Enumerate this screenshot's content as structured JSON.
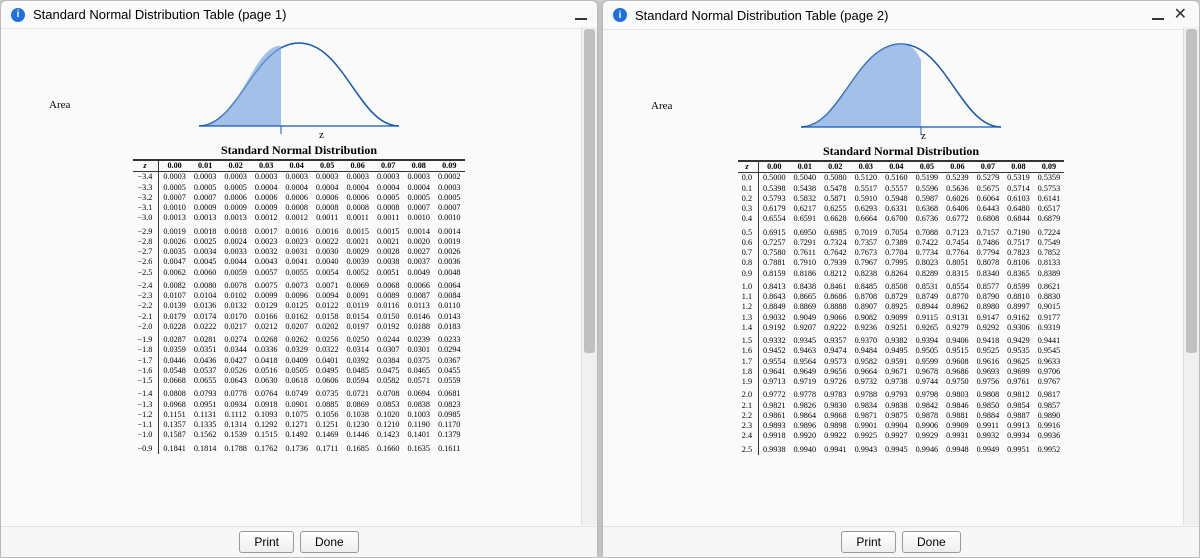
{
  "windows": [
    {
      "title": "Standard Normal Distribution Table (page 1)",
      "dist_title": "Standard Normal Distribution",
      "area_label": "Area",
      "z_label": "z"
    },
    {
      "title": "Standard Normal Distribution Table (page 2)",
      "dist_title": "Standard Normal Distribution",
      "area_label": "Area",
      "z_label": "z"
    }
  ],
  "buttons": {
    "print": "Print",
    "done": "Done"
  },
  "col_headers": [
    "z",
    "0.00",
    "0.01",
    "0.02",
    "0.03",
    "0.04",
    "0.05",
    "0.06",
    "0.07",
    "0.08",
    "0.09"
  ],
  "chart_data": [
    {
      "type": "table",
      "title": "Standard Normal Distribution (page 1, negative z)",
      "headers": [
        "z",
        "0.00",
        "0.01",
        "0.02",
        "0.03",
        "0.04",
        "0.05",
        "0.06",
        "0.07",
        "0.08",
        "0.09"
      ],
      "rows": [
        [
          "−3.4",
          "0.0003",
          "0.0003",
          "0.0003",
          "0.0003",
          "0.0003",
          "0.0003",
          "0.0003",
          "0.0003",
          "0.0003",
          "0.0002"
        ],
        [
          "−3.3",
          "0.0005",
          "0.0005",
          "0.0005",
          "0.0004",
          "0.0004",
          "0.0004",
          "0.0004",
          "0.0004",
          "0.0004",
          "0.0003"
        ],
        [
          "−3.2",
          "0.0007",
          "0.0007",
          "0.0006",
          "0.0006",
          "0.0006",
          "0.0006",
          "0.0006",
          "0.0005",
          "0.0005",
          "0.0005"
        ],
        [
          "−3.1",
          "0.0010",
          "0.0009",
          "0.0009",
          "0.0009",
          "0.0008",
          "0.0008",
          "0.0008",
          "0.0008",
          "0.0007",
          "0.0007"
        ],
        [
          "−3.0",
          "0.0013",
          "0.0013",
          "0.0013",
          "0.0012",
          "0.0012",
          "0.0011",
          "0.0011",
          "0.0011",
          "0.0010",
          "0.0010"
        ],
        [
          "−2.9",
          "0.0019",
          "0.0018",
          "0.0018",
          "0.0017",
          "0.0016",
          "0.0016",
          "0.0015",
          "0.0015",
          "0.0014",
          "0.0014"
        ],
        [
          "−2.8",
          "0.0026",
          "0.0025",
          "0.0024",
          "0.0023",
          "0.0023",
          "0.0022",
          "0.0021",
          "0.0021",
          "0.0020",
          "0.0019"
        ],
        [
          "−2.7",
          "0.0035",
          "0.0034",
          "0.0033",
          "0.0032",
          "0.0031",
          "0.0030",
          "0.0029",
          "0.0028",
          "0.0027",
          "0.0026"
        ],
        [
          "−2.6",
          "0.0047",
          "0.0045",
          "0.0044",
          "0.0043",
          "0.0041",
          "0.0040",
          "0.0039",
          "0.0038",
          "0.0037",
          "0.0036"
        ],
        [
          "−2.5",
          "0.0062",
          "0.0060",
          "0.0059",
          "0.0057",
          "0.0055",
          "0.0054",
          "0.0052",
          "0.0051",
          "0.0049",
          "0.0048"
        ],
        [
          "−2.4",
          "0.0082",
          "0.0080",
          "0.0078",
          "0.0075",
          "0.0073",
          "0.0071",
          "0.0069",
          "0.0068",
          "0.0066",
          "0.0064"
        ],
        [
          "−2.3",
          "0.0107",
          "0.0104",
          "0.0102",
          "0.0099",
          "0.0096",
          "0.0094",
          "0.0091",
          "0.0089",
          "0.0087",
          "0.0084"
        ],
        [
          "−2.2",
          "0.0139",
          "0.0136",
          "0.0132",
          "0.0129",
          "0.0125",
          "0.0122",
          "0.0119",
          "0.0116",
          "0.0113",
          "0.0110"
        ],
        [
          "−2.1",
          "0.0179",
          "0.0174",
          "0.0170",
          "0.0166",
          "0.0162",
          "0.0158",
          "0.0154",
          "0.0150",
          "0.0146",
          "0.0143"
        ],
        [
          "−2.0",
          "0.0228",
          "0.0222",
          "0.0217",
          "0.0212",
          "0.0207",
          "0.0202",
          "0.0197",
          "0.0192",
          "0.0188",
          "0.0183"
        ],
        [
          "−1.9",
          "0.0287",
          "0.0281",
          "0.0274",
          "0.0268",
          "0.0262",
          "0.0256",
          "0.0250",
          "0.0244",
          "0.0239",
          "0.0233"
        ],
        [
          "−1.8",
          "0.0359",
          "0.0351",
          "0.0344",
          "0.0336",
          "0.0329",
          "0.0322",
          "0.0314",
          "0.0307",
          "0.0301",
          "0.0294"
        ],
        [
          "−1.7",
          "0.0446",
          "0.0436",
          "0.0427",
          "0.0418",
          "0.0409",
          "0.0401",
          "0.0392",
          "0.0384",
          "0.0375",
          "0.0367"
        ],
        [
          "−1.6",
          "0.0548",
          "0.0537",
          "0.0526",
          "0.0516",
          "0.0505",
          "0.0495",
          "0.0485",
          "0.0475",
          "0.0465",
          "0.0455"
        ],
        [
          "−1.5",
          "0.0668",
          "0.0655",
          "0.0643",
          "0.0630",
          "0.0618",
          "0.0606",
          "0.0594",
          "0.0582",
          "0.0571",
          "0.0559"
        ],
        [
          "−1.4",
          "0.0808",
          "0.0793",
          "0.0778",
          "0.0764",
          "0.0749",
          "0.0735",
          "0.0721",
          "0.0708",
          "0.0694",
          "0.0681"
        ],
        [
          "−1.3",
          "0.0968",
          "0.0951",
          "0.0934",
          "0.0918",
          "0.0901",
          "0.0885",
          "0.0869",
          "0.0853",
          "0.0838",
          "0.0823"
        ],
        [
          "−1.2",
          "0.1151",
          "0.1131",
          "0.1112",
          "0.1093",
          "0.1075",
          "0.1056",
          "0.1038",
          "0.1020",
          "0.1003",
          "0.0985"
        ],
        [
          "−1.1",
          "0.1357",
          "0.1335",
          "0.1314",
          "0.1292",
          "0.1271",
          "0.1251",
          "0.1230",
          "0.1210",
          "0.1190",
          "0.1170"
        ],
        [
          "−1.0",
          "0.1587",
          "0.1562",
          "0.1539",
          "0.1515",
          "0.1492",
          "0.1469",
          "0.1446",
          "0.1423",
          "0.1401",
          "0.1379"
        ],
        [
          "−0.9",
          "0.1841",
          "0.1814",
          "0.1788",
          "0.1762",
          "0.1736",
          "0.1711",
          "0.1685",
          "0.1660",
          "0.1635",
          "0.1611"
        ]
      ],
      "groups": [
        5,
        5,
        5,
        5,
        5,
        1
      ]
    },
    {
      "type": "table",
      "title": "Standard Normal Distribution (page 2, non-negative z)",
      "headers": [
        "z",
        "0.00",
        "0.01",
        "0.02",
        "0.03",
        "0.04",
        "0.05",
        "0.06",
        "0.07",
        "0.08",
        "0.09"
      ],
      "rows": [
        [
          "0.0",
          "0.5000",
          "0.5040",
          "0.5080",
          "0.5120",
          "0.5160",
          "0.5199",
          "0.5239",
          "0.5279",
          "0.5319",
          "0.5359"
        ],
        [
          "0.1",
          "0.5398",
          "0.5438",
          "0.5478",
          "0.5517",
          "0.5557",
          "0.5596",
          "0.5636",
          "0.5675",
          "0.5714",
          "0.5753"
        ],
        [
          "0.2",
          "0.5793",
          "0.5832",
          "0.5871",
          "0.5910",
          "0.5948",
          "0.5987",
          "0.6026",
          "0.6064",
          "0.6103",
          "0.6141"
        ],
        [
          "0.3",
          "0.6179",
          "0.6217",
          "0.6255",
          "0.6293",
          "0.6331",
          "0.6368",
          "0.6406",
          "0.6443",
          "0.6480",
          "0.6517"
        ],
        [
          "0.4",
          "0.6554",
          "0.6591",
          "0.6628",
          "0.6664",
          "0.6700",
          "0.6736",
          "0.6772",
          "0.6808",
          "0.6844",
          "0.6879"
        ],
        [
          "0.5",
          "0.6915",
          "0.6950",
          "0.6985",
          "0.7019",
          "0.7054",
          "0.7088",
          "0.7123",
          "0.7157",
          "0.7190",
          "0.7224"
        ],
        [
          "0.6",
          "0.7257",
          "0.7291",
          "0.7324",
          "0.7357",
          "0.7389",
          "0.7422",
          "0.7454",
          "0.7486",
          "0.7517",
          "0.7549"
        ],
        [
          "0.7",
          "0.7580",
          "0.7611",
          "0.7642",
          "0.7673",
          "0.7704",
          "0.7734",
          "0.7764",
          "0.7794",
          "0.7823",
          "0.7852"
        ],
        [
          "0.8",
          "0.7881",
          "0.7910",
          "0.7939",
          "0.7967",
          "0.7995",
          "0.8023",
          "0.8051",
          "0.8078",
          "0.8106",
          "0.8133"
        ],
        [
          "0.9",
          "0.8159",
          "0.8186",
          "0.8212",
          "0.8238",
          "0.8264",
          "0.8289",
          "0.8315",
          "0.8340",
          "0.8365",
          "0.8389"
        ],
        [
          "1.0",
          "0.8413",
          "0.8438",
          "0.8461",
          "0.8485",
          "0.8508",
          "0.8531",
          "0.8554",
          "0.8577",
          "0.8599",
          "0.8621"
        ],
        [
          "1.1",
          "0.8643",
          "0.8665",
          "0.8686",
          "0.8708",
          "0.8729",
          "0.8749",
          "0.8770",
          "0.8790",
          "0.8810",
          "0.8830"
        ],
        [
          "1.2",
          "0.8849",
          "0.8869",
          "0.8888",
          "0.8907",
          "0.8925",
          "0.8944",
          "0.8962",
          "0.8980",
          "0.8997",
          "0.9015"
        ],
        [
          "1.3",
          "0.9032",
          "0.9049",
          "0.9066",
          "0.9082",
          "0.9099",
          "0.9115",
          "0.9131",
          "0.9147",
          "0.9162",
          "0.9177"
        ],
        [
          "1.4",
          "0.9192",
          "0.9207",
          "0.9222",
          "0.9236",
          "0.9251",
          "0.9265",
          "0.9279",
          "0.9292",
          "0.9306",
          "0.9319"
        ],
        [
          "1.5",
          "0.9332",
          "0.9345",
          "0.9357",
          "0.9370",
          "0.9382",
          "0.9394",
          "0.9406",
          "0.9418",
          "0.9429",
          "0.9441"
        ],
        [
          "1.6",
          "0.9452",
          "0.9463",
          "0.9474",
          "0.9484",
          "0.9495",
          "0.9505",
          "0.9515",
          "0.9525",
          "0.9535",
          "0.9545"
        ],
        [
          "1.7",
          "0.9554",
          "0.9564",
          "0.9573",
          "0.9582",
          "0.9591",
          "0.9599",
          "0.9608",
          "0.9616",
          "0.9625",
          "0.9633"
        ],
        [
          "1.8",
          "0.9641",
          "0.9649",
          "0.9656",
          "0.9664",
          "0.9671",
          "0.9678",
          "0.9686",
          "0.9693",
          "0.9699",
          "0.9706"
        ],
        [
          "1.9",
          "0.9713",
          "0.9719",
          "0.9726",
          "0.9732",
          "0.9738",
          "0.9744",
          "0.9750",
          "0.9756",
          "0.9761",
          "0.9767"
        ],
        [
          "2.0",
          "0.9772",
          "0.9778",
          "0.9783",
          "0.9788",
          "0.9793",
          "0.9798",
          "0.9803",
          "0.9808",
          "0.9812",
          "0.9817"
        ],
        [
          "2.1",
          "0.9821",
          "0.9826",
          "0.9830",
          "0.9834",
          "0.9838",
          "0.9842",
          "0.9846",
          "0.9850",
          "0.9854",
          "0.9857"
        ],
        [
          "2.2",
          "0.9861",
          "0.9864",
          "0.9868",
          "0.9871",
          "0.9875",
          "0.9878",
          "0.9881",
          "0.9884",
          "0.9887",
          "0.9890"
        ],
        [
          "2.3",
          "0.9893",
          "0.9896",
          "0.9898",
          "0.9901",
          "0.9904",
          "0.9906",
          "0.9909",
          "0.9911",
          "0.9913",
          "0.9916"
        ],
        [
          "2.4",
          "0.9918",
          "0.9920",
          "0.9922",
          "0.9925",
          "0.9927",
          "0.9929",
          "0.9931",
          "0.9932",
          "0.9934",
          "0.9936"
        ],
        [
          "2.5",
          "0.9938",
          "0.9940",
          "0.9941",
          "0.9943",
          "0.9945",
          "0.9946",
          "0.9948",
          "0.9949",
          "0.9951",
          "0.9952"
        ]
      ],
      "groups": [
        5,
        5,
        5,
        5,
        5,
        1
      ]
    }
  ]
}
